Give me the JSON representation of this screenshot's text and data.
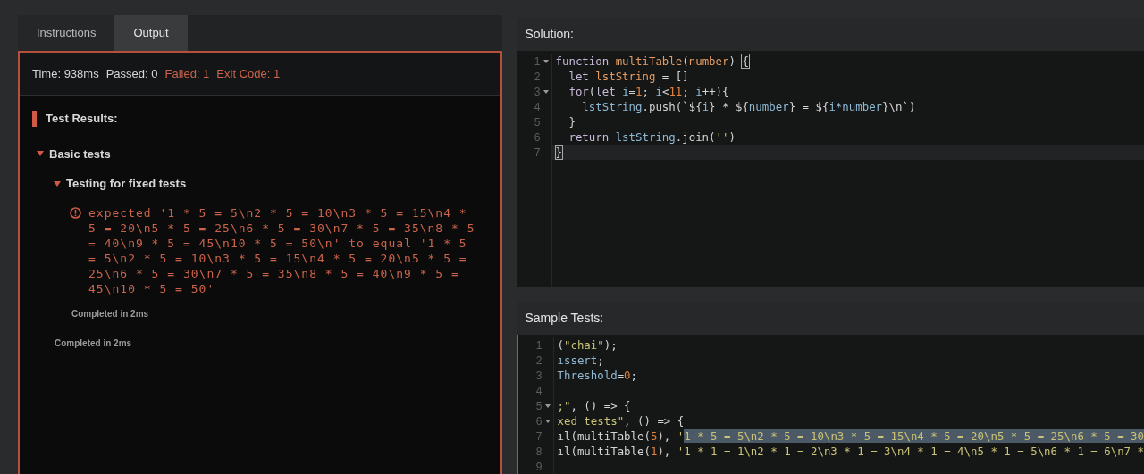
{
  "tabs": [
    {
      "label": "Instructions",
      "selected": false
    },
    {
      "label": "Output",
      "selected": true
    }
  ],
  "output": {
    "summary": [
      {
        "text": "Time: 938ms",
        "kind": "info"
      },
      {
        "text": "Passed: 0",
        "kind": "info"
      },
      {
        "text": "Failed: 1",
        "kind": "fail"
      },
      {
        "text": "Exit Code: 1",
        "kind": "fail"
      }
    ],
    "heading": "Test Results:",
    "groups": [
      {
        "label": "Basic tests",
        "expanded": true,
        "children": [
          {
            "label": "Testing for fixed tests",
            "expanded": true,
            "error": "expected '1 * 5 = 5\\n2 * 5 = 10\\n3 * 5 = 15\\n4 * 5 = 20\\n5 * 5 = 25\\n6 * 5 = 30\\n7 * 5 = 35\\n8 * 5 = 40\\n9 * 5 = 45\\n10 * 5 = 50\\n' to equal '1 * 5 = 5\\n2 * 5 = 10\\n3 * 5 = 15\\n4 * 5 = 20\\n5 * 5 = 25\\n6 * 5 = 30\\n7 * 5 = 35\\n8 * 5 = 40\\n9 * 5 = 45\\n10 * 5 = 50'",
            "completed": "Completed in 2ms"
          }
        ],
        "completed": "Completed in 2ms"
      }
    ]
  },
  "solution": {
    "title": "Solution:",
    "lines": [
      {
        "number": "1",
        "foldable": true,
        "active": false,
        "segments": [
          {
            "text": "function ",
            "kind": "kw"
          },
          {
            "text": "multiTable",
            "kind": "fn"
          },
          {
            "text": "(",
            "kind": "plain"
          },
          {
            "text": "number",
            "kind": "fn"
          },
          {
            "text": ") ",
            "kind": "plain"
          },
          {
            "text": "{",
            "kind": "bracket"
          }
        ]
      },
      {
        "number": "2",
        "foldable": false,
        "active": false,
        "segments": [
          {
            "text": "  let ",
            "kind": "kw"
          },
          {
            "text": "lstString",
            "kind": "fn"
          },
          {
            "text": " = []",
            "kind": "plain"
          }
        ]
      },
      {
        "number": "3",
        "foldable": true,
        "active": false,
        "segments": [
          {
            "text": "  for",
            "kind": "kw"
          },
          {
            "text": "(",
            "kind": "plain"
          },
          {
            "text": "let ",
            "kind": "kw"
          },
          {
            "text": "i",
            "kind": "var"
          },
          {
            "text": "=",
            "kind": "plain"
          },
          {
            "text": "1",
            "kind": "num"
          },
          {
            "text": "; ",
            "kind": "plain"
          },
          {
            "text": "i",
            "kind": "var"
          },
          {
            "text": "<",
            "kind": "plain"
          },
          {
            "text": "11",
            "kind": "num"
          },
          {
            "text": "; ",
            "kind": "plain"
          },
          {
            "text": "i",
            "kind": "var"
          },
          {
            "text": "++){",
            "kind": "plain"
          }
        ]
      },
      {
        "number": "4",
        "foldable": false,
        "active": false,
        "segments": [
          {
            "text": "    lstString",
            "kind": "var"
          },
          {
            "text": ".push(`${",
            "kind": "plain"
          },
          {
            "text": "i",
            "kind": "var"
          },
          {
            "text": "} * ${",
            "kind": "plain"
          },
          {
            "text": "number",
            "kind": "var"
          },
          {
            "text": "} = ${",
            "kind": "plain"
          },
          {
            "text": "i*number",
            "kind": "var"
          },
          {
            "text": "}\\n`)",
            "kind": "plain"
          }
        ]
      },
      {
        "number": "5",
        "foldable": false,
        "active": false,
        "segments": [
          {
            "text": "  }",
            "kind": "plain"
          }
        ]
      },
      {
        "number": "6",
        "foldable": false,
        "active": false,
        "segments": [
          {
            "text": "  return ",
            "kind": "kw"
          },
          {
            "text": "lstString",
            "kind": "var"
          },
          {
            "text": ".join(",
            "kind": "plain"
          },
          {
            "text": "''",
            "kind": "str"
          },
          {
            "text": ")",
            "kind": "plain"
          }
        ]
      },
      {
        "number": "7",
        "foldable": false,
        "active": true,
        "segments": [
          {
            "text": "}",
            "kind": "bracket"
          }
        ]
      }
    ]
  },
  "sample_tests": {
    "title": "Sample Tests:",
    "lines": [
      {
        "number": "1",
        "foldable": false,
        "active": false,
        "segments": [
          {
            "text": "(",
            "kind": "plain"
          },
          {
            "text": "\"chai\"",
            "kind": "str"
          },
          {
            "text": ");",
            "kind": "plain"
          }
        ]
      },
      {
        "number": "2",
        "foldable": false,
        "active": false,
        "segments": [
          {
            "text": "ıssert",
            "kind": "var"
          },
          {
            "text": ";",
            "kind": "plain"
          }
        ]
      },
      {
        "number": "3",
        "foldable": false,
        "active": false,
        "segments": [
          {
            "text": "Threshold",
            "kind": "var"
          },
          {
            "text": "=",
            "kind": "plain"
          },
          {
            "text": "0",
            "kind": "num"
          },
          {
            "text": ";",
            "kind": "plain"
          }
        ]
      },
      {
        "number": "4",
        "foldable": false,
        "active": false
      },
      {
        "number": "5",
        "foldable": true,
        "active": false,
        "segments": [
          {
            "text": ";\"",
            "kind": "str"
          },
          {
            "text": ", () => {",
            "kind": "plain"
          }
        ]
      },
      {
        "number": "6",
        "foldable": true,
        "active": false,
        "segments": [
          {
            "text": "xed tests\"",
            "kind": "str"
          },
          {
            "text": ", () => {",
            "kind": "plain"
          }
        ]
      },
      {
        "number": "7",
        "foldable": false,
        "active": false,
        "segments": [
          {
            "text": "ıl(multiTable(",
            "kind": "plain"
          },
          {
            "text": "5",
            "kind": "num"
          },
          {
            "text": "), ",
            "kind": "plain"
          },
          {
            "text": "'",
            "kind": "str"
          },
          {
            "text": "1 * 5 = 5\\n2 * 5 = 10\\n3 * 5 = 15\\n4 * 5 = 20\\n5 * 5 = 25\\n6 * 5 = 30",
            "kind": "selected"
          }
        ]
      },
      {
        "number": "8",
        "foldable": false,
        "active": false,
        "segments": [
          {
            "text": "ıl(multiTable(",
            "kind": "plain"
          },
          {
            "text": "1",
            "kind": "num"
          },
          {
            "text": "), ",
            "kind": "plain"
          },
          {
            "text": "'1 * 1 = 1\\n2 * 1 = 2\\n3 * 1 = 3\\n4 * 1 = 4\\n5 * 1 = 5\\n6 * 1 = 6\\n7 *",
            "kind": "str"
          }
        ]
      },
      {
        "number": "9",
        "foldable": false,
        "active": false
      }
    ]
  }
}
